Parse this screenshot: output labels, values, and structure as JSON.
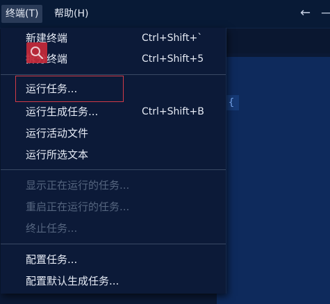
{
  "menubar": {
    "items": [
      {
        "label": "终端(T)"
      },
      {
        "label": "帮助(H)"
      }
    ]
  },
  "terminal_menu": {
    "groups": [
      [
        {
          "label": "新建终端",
          "shortcut": "Ctrl+Shift+`",
          "enabled": true
        },
        {
          "label": "拆分终端",
          "shortcut": "Ctrl+Shift+5",
          "enabled": true
        }
      ],
      [
        {
          "label": "运行任务...",
          "shortcut": "",
          "enabled": true,
          "focused": true
        },
        {
          "label": "运行生成任务...",
          "shortcut": "Ctrl+Shift+B",
          "enabled": true
        },
        {
          "label": "运行活动文件",
          "shortcut": "",
          "enabled": true
        },
        {
          "label": "运行所选文本",
          "shortcut": "",
          "enabled": true
        }
      ],
      [
        {
          "label": "显示正在运行的任务...",
          "shortcut": "",
          "enabled": false
        },
        {
          "label": "重启正在运行的任务...",
          "shortcut": "",
          "enabled": false
        },
        {
          "label": "终止任务...",
          "shortcut": "",
          "enabled": false
        }
      ],
      [
        {
          "label": "配置任务...",
          "shortcut": "",
          "enabled": true
        },
        {
          "label": "配置默认生成任务...",
          "shortcut": "",
          "enabled": true
        }
      ]
    ]
  },
  "editor": {
    "visible_token": "{"
  },
  "icons": {
    "back": "arrow-left-icon",
    "forward": "arrow-right-icon",
    "overlay": "search-icon"
  },
  "colors": {
    "menu_bg": "#0c1a38",
    "focus_border": "#d23b47",
    "disabled_text": "#55657f",
    "overlay_red": "#c52a3a"
  }
}
